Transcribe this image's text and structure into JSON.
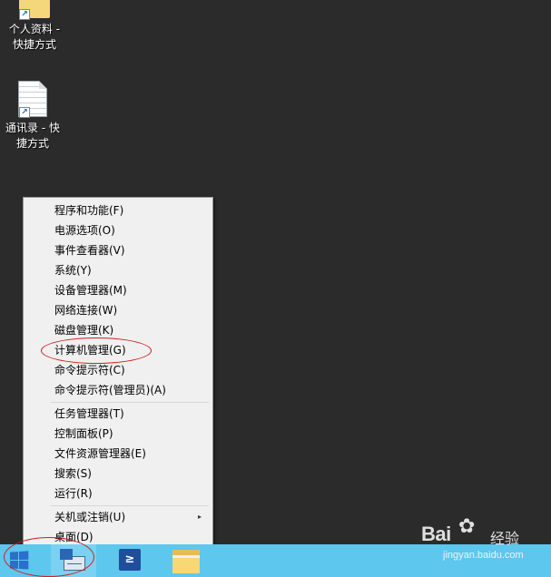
{
  "desktop": {
    "icons": [
      {
        "label_line1": "个人资料 -",
        "label_line2": "快捷方式",
        "icon": "folder-shortcut-icon"
      },
      {
        "label_line1": "通讯录 - 快",
        "label_line2": "捷方式",
        "icon": "text-document-shortcut-icon"
      }
    ]
  },
  "context_menu": {
    "items": [
      {
        "label": "程序和功能(F)"
      },
      {
        "label": "电源选项(O)"
      },
      {
        "label": "事件查看器(V)"
      },
      {
        "label": "系统(Y)"
      },
      {
        "label": "设备管理器(M)"
      },
      {
        "label": "网络连接(W)"
      },
      {
        "label": "磁盘管理(K)"
      },
      {
        "label": "计算机管理(G)",
        "highlighted": true
      },
      {
        "label": "命令提示符(C)"
      },
      {
        "label": "命令提示符(管理员)(A)"
      },
      {
        "label": "任务管理器(T)"
      },
      {
        "label": "控制面板(P)"
      },
      {
        "label": "文件资源管理器(E)"
      },
      {
        "label": "搜索(S)"
      },
      {
        "label": "运行(R)"
      },
      {
        "label": "关机或注销(U)",
        "has_submenu": true
      },
      {
        "label": "桌面(D)"
      }
    ],
    "submenu_arrow": "▸"
  },
  "taskbar": {
    "buttons": [
      {
        "name": "start",
        "icon": "windows-logo-icon"
      },
      {
        "name": "server-manager",
        "icon": "server-manager-icon"
      },
      {
        "name": "powershell",
        "icon": "powershell-icon",
        "glyph": "≥"
      },
      {
        "name": "file-explorer",
        "icon": "folder-icon"
      }
    ],
    "color": "#5dc7ee"
  },
  "watermark": {
    "brand": "Bai",
    "brand_paw": "✿",
    "brand_text": "经验",
    "url": "jingyan.baidu.com"
  },
  "colors": {
    "desktop_bg": "#2b2b2b",
    "menu_bg": "#f0f0f0",
    "annotation_red": "#d21d1d"
  }
}
